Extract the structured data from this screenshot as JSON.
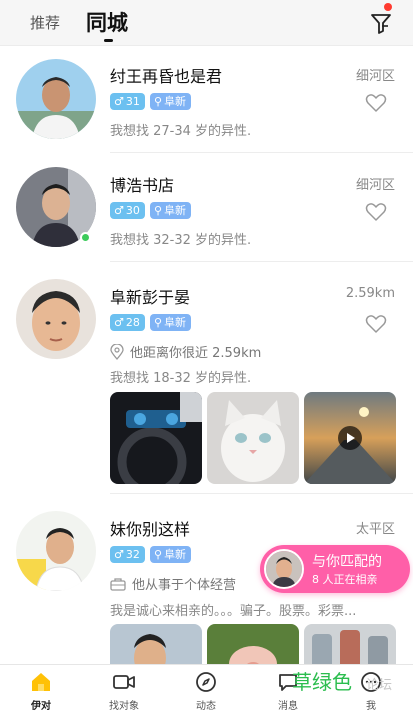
{
  "header": {
    "tab_recommend": "推荐",
    "tab_city": "同城"
  },
  "colors": {
    "accent": "#ffc107",
    "age_badge": "#6cc0f0",
    "loc_badge": "#7fb3f5",
    "online": "#3ccb5b",
    "match_pill": "#ff5fa8"
  },
  "cards": [
    {
      "name": "纣王再昏也是君",
      "distance": "细河区",
      "age": "31",
      "location": "阜新",
      "seek": "我想找 27-34 岁的异性.",
      "online": false
    },
    {
      "name": "博浩书店",
      "distance": "细河区",
      "age": "30",
      "location": "阜新",
      "seek": "我想找 32-32 岁的异性.",
      "online": true
    },
    {
      "name": "阜新彭于晏",
      "distance": "2.59km",
      "age": "28",
      "location": "阜新",
      "near_text": "他距离你很近 2.59km",
      "seek": "我想找 18-32 岁的异性.",
      "online": false
    },
    {
      "name": "妹你别这样",
      "distance": "太平区",
      "age": "32",
      "location": "阜新",
      "job_text": "他从事于个体经营",
      "seek": "我是诚心来相亲的。。。骗子。股票。彩票...",
      "online": false
    }
  ],
  "match": {
    "title": "与你匹配的",
    "subtitle": "8 人正在相亲"
  },
  "nav": {
    "items": [
      {
        "label": "伊对",
        "icon": "home-icon"
      },
      {
        "label": "找对象",
        "icon": "video-icon"
      },
      {
        "label": "动态",
        "icon": "compass-icon"
      },
      {
        "label": "消息",
        "icon": "message-icon"
      },
      {
        "label": "我",
        "icon": "profile-icon"
      }
    ]
  },
  "watermark": {
    "text": "草绿色",
    "suffix": "论坛"
  }
}
